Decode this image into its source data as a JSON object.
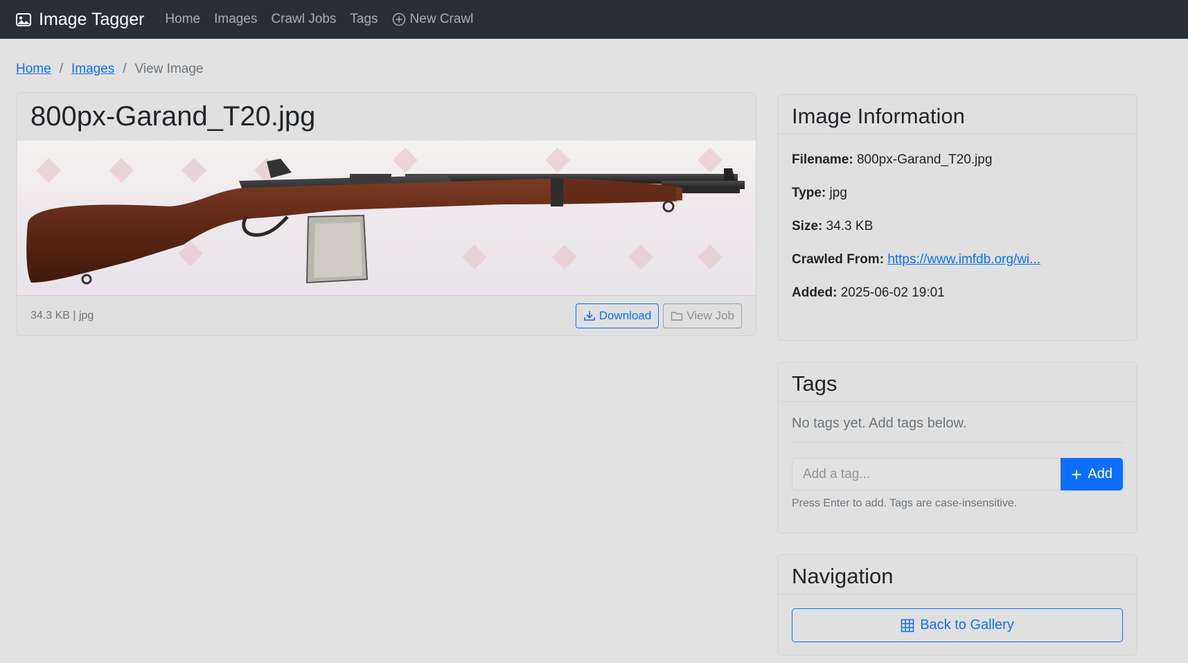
{
  "navbar": {
    "brand": "Image Tagger",
    "links": [
      "Home",
      "Images",
      "Crawl Jobs",
      "Tags"
    ],
    "new_crawl": "New Crawl"
  },
  "breadcrumb": {
    "items": [
      "Home",
      "Images"
    ],
    "separator": "/",
    "active": "View Image"
  },
  "image_card": {
    "title": "800px-Garand_T20.jpg",
    "meta": "34.3 KB | jpg",
    "download_label": "Download",
    "view_job_label": "View Job"
  },
  "info": {
    "header": "Image Information",
    "filename_label": "Filename:",
    "filename": "800px-Garand_T20.jpg",
    "type_label": "Type:",
    "type": "jpg",
    "size_label": "Size:",
    "size": "34.3 KB",
    "crawled_label": "Crawled From:",
    "crawled_url": "https://www.imfdb.org/wi...",
    "added_label": "Added:",
    "added": "2025-06-02 19:01"
  },
  "tags": {
    "header": "Tags",
    "empty_text": "No tags yet. Add tags below.",
    "input_placeholder": "Add a tag...",
    "add_label": "Add",
    "help": "Press Enter to add. Tags are case-insensitive."
  },
  "navigation": {
    "header": "Navigation",
    "back_label": "Back to Gallery"
  },
  "colors": {
    "navbar": "#2b2f35",
    "primary": "#0d6efd",
    "background": "#e2e2e2"
  }
}
